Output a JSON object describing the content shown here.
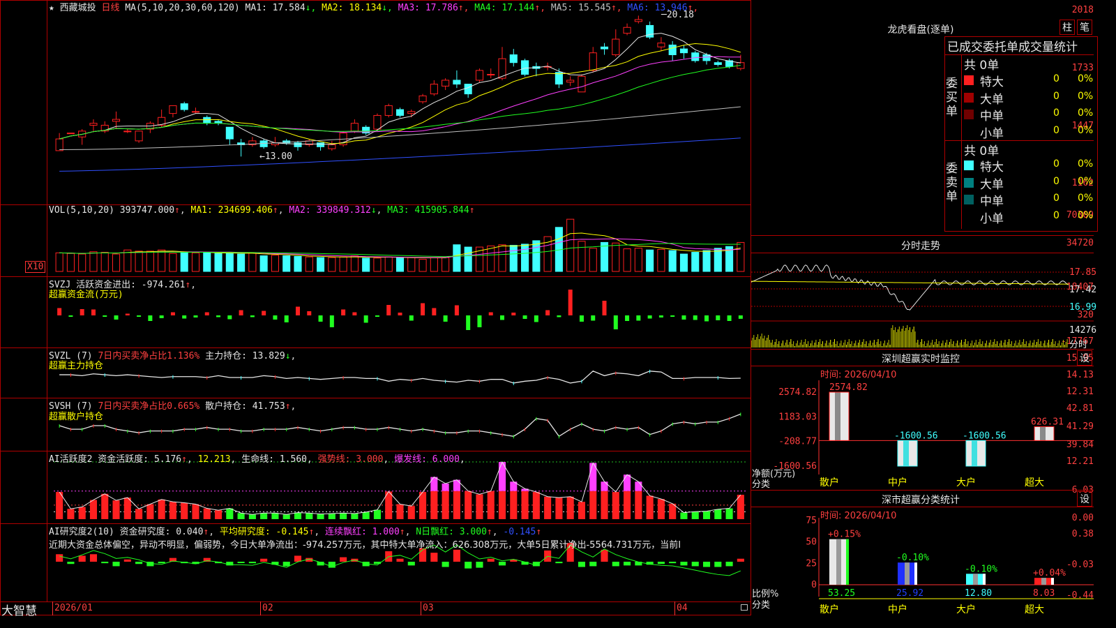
{
  "stock": {
    "name": "西藏城投",
    "period": "日线",
    "ma_params": "MA(5,10,20,30,60,120)"
  },
  "price_header": [
    {
      "label": "MA1: 17.584",
      "arrow": "↓",
      "color": "#e6e6e6"
    },
    {
      "label": "MA2: 18.134",
      "arrow": "↓",
      "color": "#ffff00"
    },
    {
      "label": "MA3: 17.786",
      "arrow": "↑",
      "color": "#ff40ff"
    },
    {
      "label": "MA4: 17.144",
      "arrow": "↑",
      "color": "#20ff20"
    },
    {
      "label": "MA5: 15.545",
      "arrow": "↑",
      "color": "#c0c0c0"
    },
    {
      "label": "MA6: 13.946",
      "arrow": "↑",
      "color": "#3050ff"
    }
  ],
  "price_axis": [
    "2018",
    "1733",
    "1447",
    "1162"
  ],
  "price_annotations": {
    "high": "20.18",
    "low": "13.00"
  },
  "vol_header": {
    "params": "VOL(5,10,20)",
    "value": "393747.000",
    "ma1": "MA1: 234699.406",
    "ma2": "MA2: 339849.312",
    "ma3": "MA3: 415905.844"
  },
  "vol_axis": [
    "70309",
    "34720"
  ],
  "vol_unit": "X10",
  "svzj": {
    "header": "SVZJ  活跃资金进出: -974.261",
    "sub": "超赢资金流(万元)",
    "axis": [
      "18407",
      "320",
      "-17767"
    ]
  },
  "svzl": {
    "header_a": "SVZL (7)",
    "header_b": "7日内买卖净占比1.136%",
    "header_c": "主力持仓: 13.829",
    "sub": "超赢主力持仓",
    "axis": [
      "15.95",
      "14.13",
      "12.31"
    ]
  },
  "svsh": {
    "header_a": "SVSH (7)",
    "header_b": "7日内买卖净占比0.665%",
    "header_c": "散户持仓: 41.753",
    "sub": "超赢散户持仓",
    "axis": [
      "42.81",
      "41.29",
      "39.84"
    ]
  },
  "ai_active": {
    "header_a": "AI活跃度2 资金活跃度: 5.176",
    "header_b": "12.213",
    "header_c": "生命线: 1.560",
    "header_d": "强势线: 3.000",
    "header_e": "爆发线: 6.000",
    "axis": [
      "12.21",
      "6.03",
      "0.00"
    ]
  },
  "ai_research": {
    "header_a": "AI研究度2(10) 资金研究度: 0.040",
    "header_b": "平均研究度: -0.145",
    "header_c": "连续飘红: 1.000",
    "header_d": "N日飘红: 3.000",
    "header_e": "-0.145",
    "commentary": "近期大资金总体偏空，异动不明显，偏弱势，今日大单净流出：-974.257万元，其中特大单净流入：626.308万元，大单5日累计净出-5564.731万元，当前I",
    "axis": [
      "0.38",
      "-0.03",
      "-0.44"
    ]
  },
  "x_axis": [
    "2026/01",
    "02",
    "03",
    "04"
  ],
  "brand": "大智慧",
  "longhu": {
    "title": "龙虎看盘(逐单)",
    "btn1": "柱",
    "btn2": "笔",
    "col_header": "已成交委托单成交量统计",
    "buy_label": "委买单",
    "sell_label": "委卖单",
    "buy_total": "共 0单",
    "sell_total": "共 0单",
    "buy_rows": [
      {
        "name": "特大",
        "count": "0",
        "pct": "0%",
        "color": "#ff2020"
      },
      {
        "name": "大单",
        "count": "0",
        "pct": "0%",
        "color": "#a00000"
      },
      {
        "name": "中单",
        "count": "0",
        "pct": "0%",
        "color": "#700000"
      },
      {
        "name": "小单",
        "count": "0",
        "pct": "0%",
        "color": "#000000"
      }
    ],
    "sell_rows": [
      {
        "name": "特大",
        "count": "0",
        "pct": "0%",
        "color": "#40ffff"
      },
      {
        "name": "大单",
        "count": "0",
        "pct": "0%",
        "color": "#008080"
      },
      {
        "name": "中单",
        "count": "0",
        "pct": "0%",
        "color": "#006060"
      },
      {
        "name": "小单",
        "count": "0",
        "pct": "0%",
        "color": "#000000"
      }
    ]
  },
  "intraday": {
    "title": "分时走势",
    "axis": [
      "17.85",
      "17.42",
      "16.99"
    ],
    "vol_axis": "14276",
    "vol_label": "分时"
  },
  "sz_monitor": {
    "title": "深圳超赢实时监控",
    "btn": "设",
    "date": "时间: 2026/04/10",
    "axis": [
      "2574.82",
      "1183.03",
      "-208.77",
      "-1600.56"
    ],
    "ylabel": "净额(万元)",
    "xlabel": "分类",
    "categories": [
      "散户",
      "中户",
      "大户",
      "超大"
    ]
  },
  "sz_category": {
    "title": "深市超赢分类统计",
    "btn": "设",
    "date": "时间: 2026/04/10",
    "axis": [
      "75",
      "50",
      "25",
      "0"
    ],
    "ylabel": "比例%",
    "xlabel": "分类",
    "categories": [
      "散户",
      "中户",
      "大户",
      "超大"
    ],
    "pct_labels": [
      "+0.15%",
      "-0.10%",
      "-0.10%",
      "+0.04%"
    ],
    "value_labels": [
      "53.25",
      "25.92",
      "12.80",
      "8.03"
    ]
  },
  "chart_data": [
    {
      "type": "candlestick",
      "title": "西藏城投 日线",
      "x": [
        "2026/01",
        "02",
        "03",
        "04"
      ],
      "ohlc": [
        [
          13.3,
          13.9,
          13.6,
          14.2
        ],
        [
          14.2,
          14.2,
          14.0,
          14.0
        ],
        [
          14.0,
          14.3,
          13.6,
          14.4
        ],
        [
          14.6,
          14.7,
          14.3,
          14.9
        ],
        [
          14.3,
          14.6,
          14.2,
          14.8
        ],
        [
          14.8,
          14.9,
          14.4,
          15.3
        ],
        [
          14.3,
          14.3,
          14.2,
          14.4
        ],
        [
          13.8,
          14.3,
          13.7,
          14.3
        ],
        [
          14.4,
          14.7,
          14.2,
          14.8
        ],
        [
          14.6,
          15.0,
          14.5,
          15.4
        ],
        [
          15.2,
          15.6,
          15.0,
          15.6
        ],
        [
          15.7,
          15.4,
          15.3,
          15.8
        ],
        [
          15.3,
          15.3,
          15.2,
          15.5
        ],
        [
          15.0,
          14.7,
          14.6,
          15.1
        ],
        [
          14.8,
          14.7,
          14.6,
          14.9
        ],
        [
          14.5,
          13.9,
          13.6,
          14.5
        ],
        [
          13.7,
          13.6,
          13.0,
          13.9
        ],
        [
          13.6,
          13.8,
          13.5,
          14.0
        ],
        [
          13.8,
          13.5,
          13.4,
          13.9
        ],
        [
          13.6,
          13.7,
          13.5,
          14.0
        ],
        [
          13.8,
          13.7,
          13.6,
          13.9
        ],
        [
          13.7,
          13.5,
          13.3,
          13.8
        ],
        [
          13.6,
          13.8,
          13.5,
          13.9
        ],
        [
          13.7,
          13.5,
          13.3,
          13.7
        ],
        [
          13.4,
          13.6,
          13.3,
          13.8
        ],
        [
          13.6,
          14.2,
          13.5,
          14.3
        ],
        [
          14.3,
          14.7,
          14.2,
          14.9
        ],
        [
          14.5,
          14.2,
          14.1,
          14.6
        ],
        [
          14.4,
          15.1,
          14.3,
          15.2
        ],
        [
          15.1,
          15.6,
          15.0,
          15.7
        ],
        [
          15.4,
          15.1,
          15.0,
          15.5
        ],
        [
          15.2,
          15.3,
          15.0,
          15.4
        ],
        [
          15.8,
          16.1,
          15.7,
          16.2
        ],
        [
          16.2,
          16.7,
          16.1,
          16.9
        ],
        [
          16.6,
          16.9,
          16.4,
          17.0
        ],
        [
          16.9,
          16.7,
          16.5,
          17.4
        ],
        [
          16.7,
          16.2,
          16.0,
          16.7
        ],
        [
          16.9,
          17.4,
          16.8,
          17.5
        ],
        [
          17.2,
          17.2,
          17.0,
          17.5
        ],
        [
          17.0,
          18.0,
          16.9,
          18.6
        ],
        [
          18.2,
          17.8,
          17.6,
          18.5
        ],
        [
          17.9,
          17.2,
          17.1,
          18.0
        ],
        [
          17.6,
          17.5,
          17.1,
          17.8
        ],
        [
          17.6,
          17.6,
          17.4,
          17.8
        ],
        [
          17.3,
          16.7,
          16.5,
          17.5
        ],
        [
          16.8,
          16.9,
          16.6,
          17.1
        ],
        [
          16.3,
          17.1,
          16.3,
          17.2
        ],
        [
          17.4,
          18.3,
          17.3,
          18.6
        ],
        [
          18.6,
          18.5,
          18.2,
          18.8
        ],
        [
          18.2,
          19.0,
          18.1,
          19.5
        ],
        [
          19.3,
          19.6,
          19.2,
          19.8
        ],
        [
          19.9,
          20.0,
          19.8,
          20.2
        ],
        [
          19.7,
          19.1,
          19.0,
          19.9
        ],
        [
          18.6,
          18.8,
          18.4,
          19.1
        ],
        [
          18.7,
          18.2,
          17.9,
          18.9
        ],
        [
          18.5,
          18.3,
          18.0,
          18.7
        ],
        [
          18.3,
          17.9,
          17.8,
          18.4
        ],
        [
          18.2,
          17.9,
          17.7,
          18.3
        ],
        [
          17.8,
          17.7,
          17.6,
          17.9
        ],
        [
          17.9,
          17.6,
          17.5,
          18.0
        ],
        [
          17.5,
          17.8,
          17.4,
          18.2
        ]
      ]
    },
    {
      "type": "bar",
      "title": "VOL(5,10,20)",
      "series": [
        {
          "name": "VOL",
          "values": [
            32,
            31,
            30,
            34,
            33,
            30,
            37,
            35,
            35,
            37,
            31,
            32,
            32,
            33,
            31,
            31,
            30,
            32,
            27,
            28,
            27,
            26,
            25,
            24,
            24,
            25,
            27,
            23,
            23,
            25,
            24,
            24,
            21,
            24,
            24,
            46,
            42,
            42,
            44,
            46,
            45,
            47,
            53,
            60,
            76,
            90,
            52,
            40,
            50,
            49,
            39,
            40,
            37,
            38,
            36,
            30,
            33,
            36,
            40,
            43,
            50
          ]
        }
      ]
    },
    {
      "type": "bar",
      "title": "SVZJ 活跃资金进出",
      "series": [
        {
          "name": "超赢资金流(万元)",
          "values": [
            2100,
            -300,
            1800,
            1700,
            -300,
            -1200,
            500,
            -200,
            -1600,
            -800,
            900,
            -900,
            -600,
            900,
            -500,
            -1100,
            1500,
            -500,
            1300,
            -1200,
            -2000,
            2500,
            1200,
            -1800,
            -3400,
            1700,
            900,
            -2100,
            -200,
            3000,
            800,
            -1500,
            3500,
            2100,
            -1800,
            2900,
            -4200,
            -3400,
            900,
            -1300,
            800,
            -1000,
            -1900,
            1500,
            -500,
            7400,
            -1800,
            -1500,
            4200,
            -4000,
            -1600,
            -1500,
            -900,
            -600,
            -200,
            -1200,
            -1300,
            -1700,
            -1400,
            -1600,
            -974
          ]
        }
      ]
    },
    {
      "type": "line",
      "title": "SVZL 主力持仓",
      "series": [
        {
          "name": "主力持仓",
          "values": [
            14.2,
            14.2,
            14.1,
            14.3,
            14.2,
            14.1,
            14.2,
            14.1,
            14.0,
            13.9,
            14.0,
            14.0,
            14.0,
            13.9,
            14.1,
            13.9,
            13.9,
            13.9,
            14.1,
            14.0,
            13.8,
            13.9,
            13.8,
            13.7,
            13.8,
            13.9,
            13.9,
            13.8,
            13.8,
            13.5,
            13.7,
            13.6,
            13.8,
            13.6,
            13.5,
            13.4,
            13.6,
            13.5,
            13.7,
            13.7,
            13.3,
            13.5,
            13.6,
            13.9,
            13.7,
            13.3,
            13.5,
            14.6,
            14.1,
            14.4,
            14.3,
            14.1,
            14.6,
            14.5,
            13.8,
            13.8,
            13.9,
            13.9,
            13.9,
            13.8,
            13.829
          ]
        }
      ]
    },
    {
      "type": "line",
      "title": "SVSH 散户持仓",
      "series": [
        {
          "name": "散户持仓",
          "values": [
            41.1,
            40.9,
            40.9,
            41.1,
            41.1,
            40.9,
            40.8,
            40.7,
            40.8,
            40.8,
            40.8,
            40.9,
            40.9,
            41.0,
            40.9,
            40.9,
            40.8,
            40.8,
            40.9,
            40.9,
            40.9,
            41.0,
            40.9,
            40.8,
            40.9,
            41.0,
            41.0,
            40.9,
            40.9,
            41.0,
            40.9,
            40.8,
            40.9,
            40.8,
            40.7,
            40.7,
            40.8,
            40.8,
            40.7,
            40.6,
            40.5,
            40.9,
            41.5,
            41.4,
            40.5,
            40.9,
            41.2,
            40.9,
            40.8,
            41.0,
            40.9,
            41.0,
            40.6,
            40.8,
            41.2,
            41.3,
            41.2,
            41.3,
            41.3,
            41.5,
            41.753
          ]
        }
      ]
    },
    {
      "type": "bar",
      "title": "AI活跃度2",
      "series": [
        {
          "name": "资金活跃度",
          "values": [
            5.8,
            2.2,
            2.6,
            4.1,
            5.4,
            4.0,
            4.6,
            2.2,
            3.2,
            4.2,
            3.7,
            3.5,
            3.2,
            2.3,
            1.9,
            2.3,
            1.3,
            1.0,
            1.3,
            1.3,
            1.0,
            1.4,
            1.3,
            1.1,
            1.2,
            1.3,
            1.2,
            1.5,
            2.0,
            5.9,
            3.2,
            2.8,
            5.8,
            9.0,
            7.6,
            8.4,
            6.0,
            5.3,
            6.0,
            12.2,
            8.0,
            6.5,
            5.8,
            4.8,
            4.6,
            4.8,
            3.7,
            12.0,
            8.0,
            5.8,
            9.5,
            8.0,
            5.0,
            4.3,
            3.3,
            1.4,
            1.6,
            1.7,
            2.1,
            2.3,
            5.2
          ]
        }
      ],
      "lines": {
        "强势线": 3.0,
        "爆发线": 6.0
      }
    },
    {
      "type": "bar",
      "title": "AI研究度2(10)",
      "series": [
        {
          "name": "资金研究度",
          "values": [
            0.1,
            -0.03,
            0.08,
            0.1,
            -0.02,
            -0.06,
            0.03,
            -0.03,
            -0.06,
            -0.02,
            0.05,
            -0.02,
            -0.03,
            0.05,
            -0.02,
            -0.05,
            -0.01,
            -0.02,
            0.04,
            -0.04,
            -0.06,
            0.08,
            0.05,
            -0.05,
            -0.08,
            0.06,
            0.04,
            -0.06,
            -0.03,
            0.14,
            0.04,
            -0.05,
            0.18,
            0.12,
            -0.07,
            0.16,
            -0.09,
            -0.08,
            0.04,
            -0.05,
            0.03,
            -0.04,
            -0.06,
            0.15,
            -0.02,
            0.25,
            -0.07,
            -0.06,
            0.16,
            -0.06,
            -0.05,
            -0.05,
            -0.04,
            -0.03,
            -0.02,
            -0.05,
            -0.06,
            -0.07,
            -0.07,
            -0.06,
            0.04
          ]
        }
      ]
    },
    {
      "type": "bar",
      "title": "深圳超赢实时监控",
      "categories": [
        "散户",
        "中户",
        "大户",
        "超大"
      ],
      "values": [
        2574.82,
        -1600.56,
        -1600.56,
        626.31
      ],
      "ylabel": "净额(万元)",
      "xlabel": "分类"
    },
    {
      "type": "bar",
      "title": "深市超赢分类统计",
      "categories": [
        "散户",
        "中户",
        "大户",
        "超大"
      ],
      "values": [
        53.25,
        25.92,
        12.8,
        8.03
      ],
      "ylabel": "比例%",
      "xlabel": "分类",
      "ylim": [
        0,
        75
      ]
    }
  ],
  "colors": {
    "up": "#ff2020",
    "down": "#40ffff",
    "border": "#b00000",
    "bg": "#000000"
  }
}
